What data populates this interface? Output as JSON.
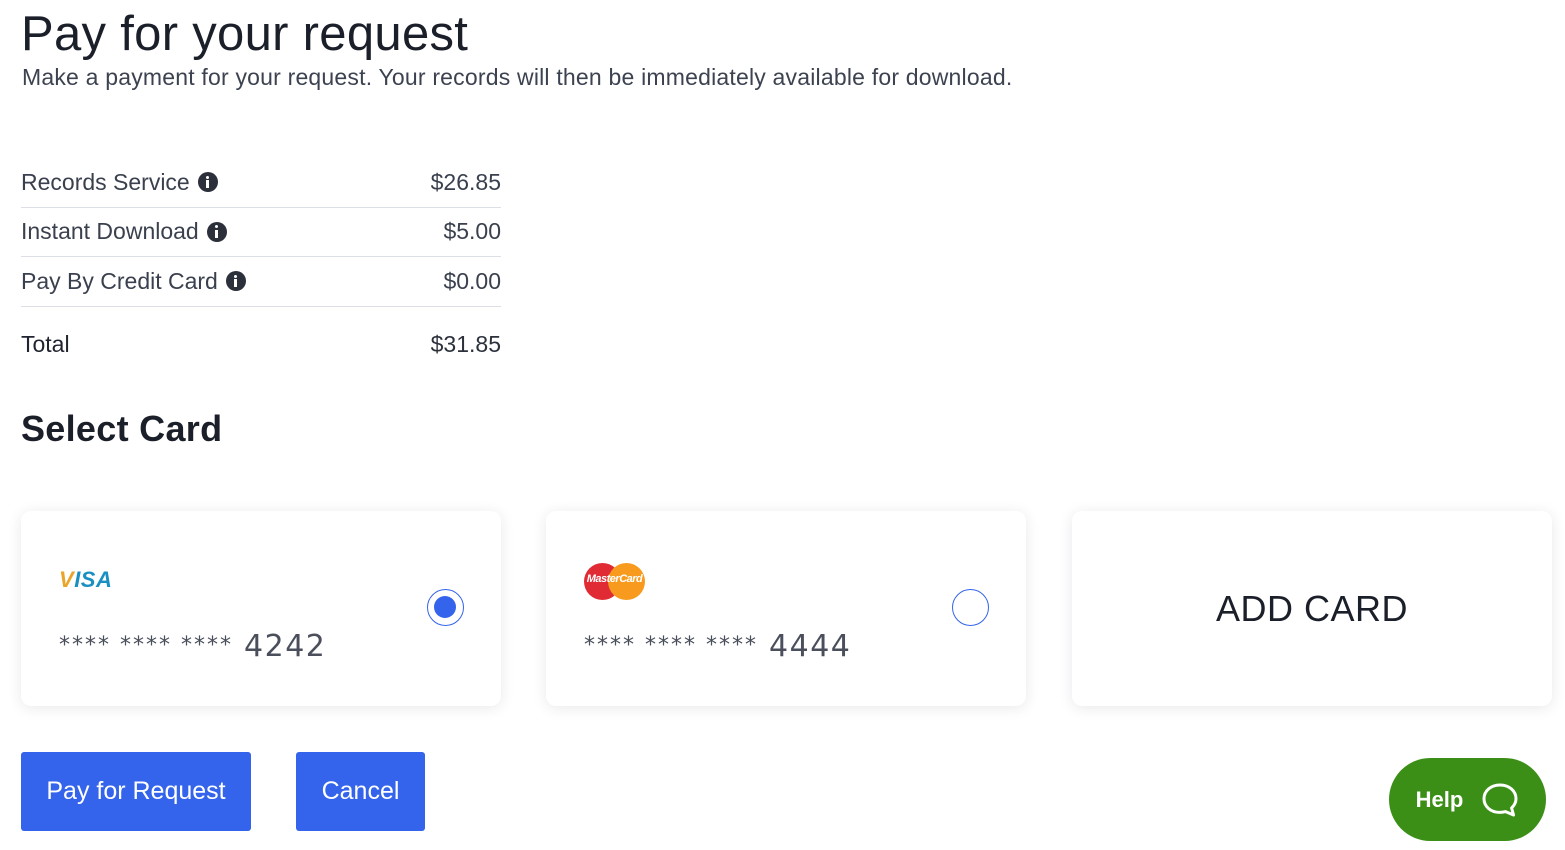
{
  "header": {
    "title": "Pay for your request",
    "subtitle": "Make a payment for your request. Your records will then be immediately available for download."
  },
  "fees": {
    "items": [
      {
        "label": "Records Service",
        "amount": "$26.85",
        "icon": "info-icon"
      },
      {
        "label": "Instant Download",
        "amount": "$5.00",
        "icon": "info-icon"
      },
      {
        "label": "Pay By Credit Card",
        "amount": "$0.00",
        "icon": "info-icon"
      }
    ],
    "total_label": "Total",
    "total_amount": "$31.85"
  },
  "select_card": {
    "title": "Select Card",
    "cards": [
      {
        "brand": "VISA",
        "mask": "**** **** ****",
        "last4": "4242",
        "selected": true
      },
      {
        "brand": "MasterCard",
        "mask": "**** **** ****",
        "last4": "4444",
        "selected": false
      }
    ],
    "add_card_label": "ADD CARD"
  },
  "actions": {
    "pay_label": "Pay for Request",
    "cancel_label": "Cancel"
  },
  "help": {
    "label": "Help",
    "icon": "chat-bubble-icon"
  },
  "colors": {
    "primary": "#3464ec",
    "help_green": "#3b8f16",
    "visa_blue": "#1a8fc2",
    "visa_gold": "#e9a42a",
    "mc_red": "#e02b35",
    "mc_orange": "#f79a1e"
  }
}
